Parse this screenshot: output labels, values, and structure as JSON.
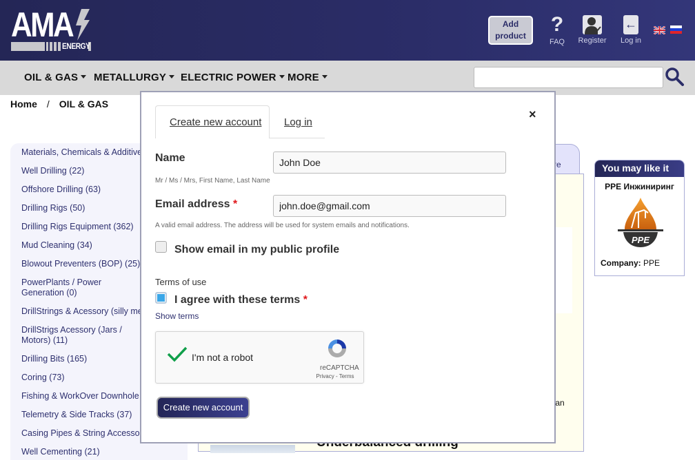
{
  "header": {
    "logo_text": "AMA",
    "logo_sub": "ENERGY",
    "add_product_line1": "Add",
    "add_product_line2": "product",
    "faq_label": "FAQ",
    "register_label": "Register",
    "login_label": "Log in",
    "languages": [
      "English",
      "Russian"
    ]
  },
  "nav": {
    "items": [
      "OIL & GAS",
      "METALLURGY",
      "ELECTRIC POWER",
      "MORE"
    ],
    "search_placeholder": "",
    "search_value": ""
  },
  "breadcrumb": {
    "home": "Home",
    "separator": "/",
    "current": "OIL & GAS"
  },
  "sidebar": {
    "items": [
      "Materials, Chemicals & Additives",
      "Well Drilling (22)",
      "Offshore Drilling (63)",
      "Drilling Rigs (50)",
      "Drilling Rigs Equipment (362)",
      "Mud Cleaning (34)",
      "Blowout Preventers (BOP) (25)",
      "PowerPlants / Power Generation (0)",
      "DrillStrings & Acessory (silly metal)",
      "DrillStrigs Acessory (Jars / Motors) (11)",
      "Drilling Bits (165)",
      "Coring (73)",
      "Fishing & WorkOver Downhole Tools",
      "Telemetry & Side Tracks (37)",
      "Casing Pipes & String Accessories",
      "Well Cementing (21)"
    ]
  },
  "content": {
    "tab_partial": "re",
    "partial_text": "tan",
    "partial_title": "Underbalanced drilling"
  },
  "recommend": {
    "title": "You may like it",
    "name": "PPE Инжиниринг",
    "logo_text": "PPE",
    "company_label": "Company:",
    "company_value": "PPE"
  },
  "modal": {
    "tabs": [
      "Create new account",
      "Log in"
    ],
    "active_tab": "Create new account",
    "close": "×",
    "name_label": "Name",
    "name_value": "John Doe",
    "name_help": "Mr / Ms / Mrs, First Name, Last Name",
    "email_label": "Email address",
    "required_mark": "*",
    "email_value": "john.doe@gmail.com",
    "email_help": "A valid email address. The address will be used for system emails and notifications.",
    "show_email_label": "Show email in my public profile",
    "show_email_checked": false,
    "terms_heading": "Terms of use",
    "agree_label": "I agree with these terms",
    "agree_checked": true,
    "show_terms": "Show terms",
    "captcha_label": "I'm not a robot",
    "captcha_brand": "reCAPTCHA",
    "captcha_links": "Privacy - Terms",
    "submit_label": "Create new account"
  }
}
